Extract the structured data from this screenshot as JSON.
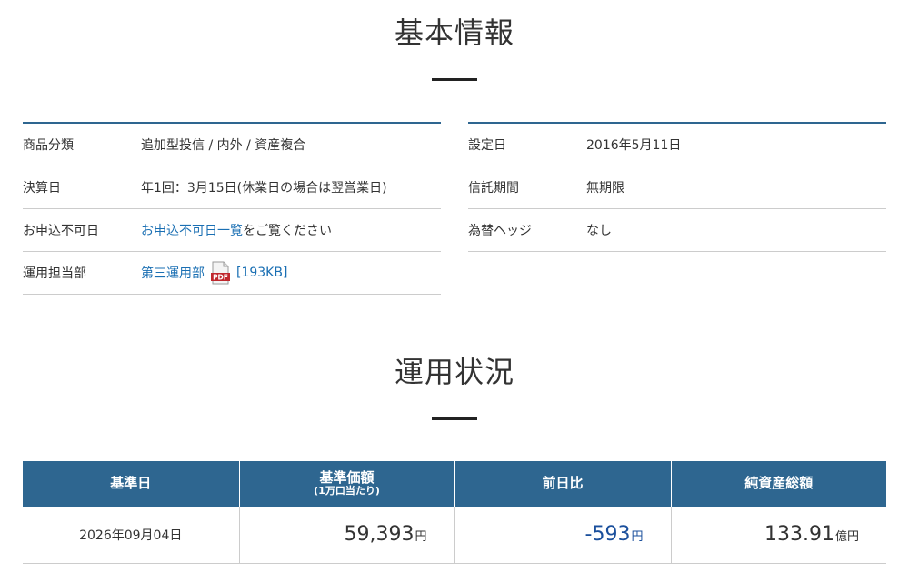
{
  "basic_info": {
    "title": "基本情報",
    "left": [
      {
        "label": "商品分類",
        "value": "追加型投信 / 内外 / 資産複合"
      },
      {
        "label": "決算日",
        "value": "年1回：3月15日(休業日の場合は翌営業日)"
      },
      {
        "label": "お申込不可日",
        "link": "お申込不可日一覧",
        "suffix": "をご覧ください"
      },
      {
        "label": "運用担当部",
        "link": "第三運用部",
        "file_size": "[193KB]",
        "icon": "pdf-icon"
      }
    ],
    "right": [
      {
        "label": "設定日",
        "value": "2016年5月11日"
      },
      {
        "label": "信託期間",
        "value": "無期限"
      },
      {
        "label": "為替ヘッジ",
        "value": "なし"
      }
    ]
  },
  "status": {
    "title": "運用状況",
    "headers": {
      "date": "基準日",
      "nav": "基準価額",
      "nav_sub": "(1万口当たり)",
      "change": "前日比",
      "net_assets": "純資産総額"
    },
    "row": {
      "date": "2026年09月04日",
      "nav": "59,393",
      "nav_unit": "円",
      "change": "-593",
      "change_unit": "円",
      "net_assets": "133.91",
      "net_assets_unit": "億円"
    }
  },
  "colors": {
    "accent": "#2e6690",
    "link": "#1a6fb3",
    "negative": "#1a4f9c"
  }
}
